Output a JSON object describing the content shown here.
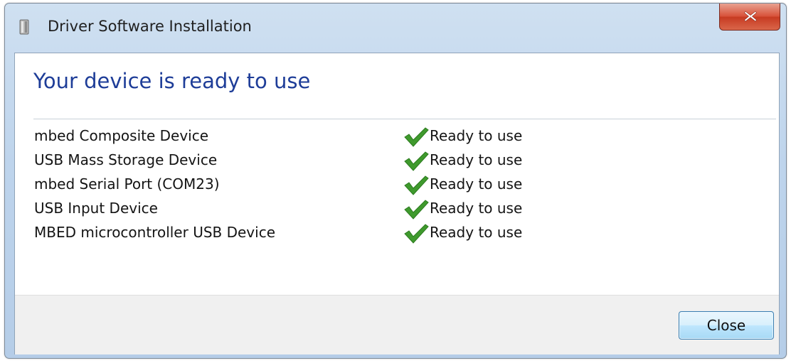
{
  "window": {
    "title": "Driver Software Installation"
  },
  "main": {
    "heading": "Your device is ready to use",
    "devices": [
      {
        "name": "mbed Composite Device",
        "status": "Ready to use"
      },
      {
        "name": "USB Mass Storage Device",
        "status": "Ready to use"
      },
      {
        "name": "mbed Serial Port (COM23)",
        "status": "Ready to use"
      },
      {
        "name": "USB Input Device",
        "status": "Ready to use"
      },
      {
        "name": "MBED microcontroller USB Device",
        "status": "Ready to use"
      }
    ]
  },
  "footer": {
    "close_label": "Close"
  },
  "icons": {
    "title": "usb-drive-icon",
    "close": "close-x-icon",
    "status": "checkmark-icon"
  },
  "colors": {
    "heading": "#1e3d98",
    "check": "#3f9a2d",
    "titlebar_close": "#d8533b",
    "button_border": "#3c7fb1"
  }
}
